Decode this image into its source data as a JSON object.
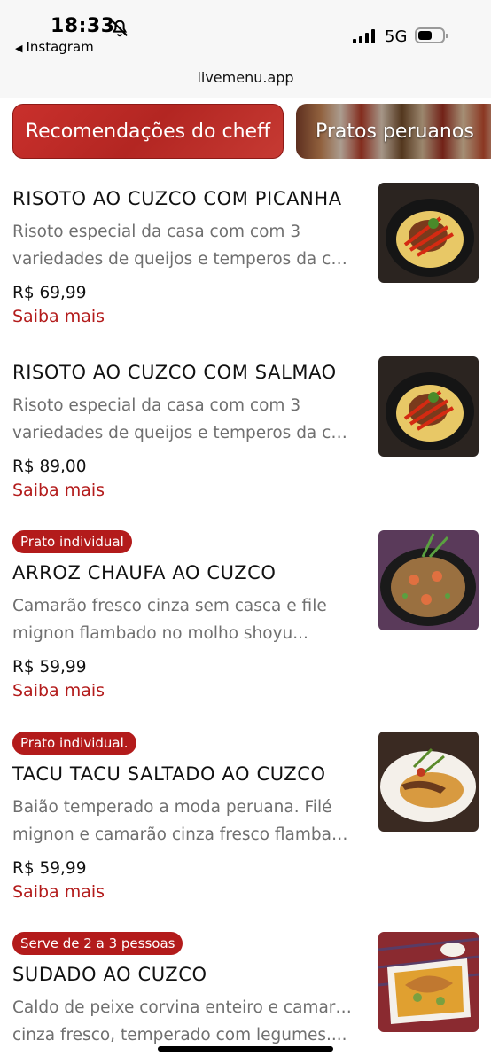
{
  "status_bar": {
    "time": "18:33",
    "back_app": "Instagram",
    "network": "5G"
  },
  "browser": {
    "url": "livemenu.app"
  },
  "categories": [
    {
      "label": "Recomendações do cheff"
    },
    {
      "label": "Pratos peruanos"
    }
  ],
  "items": [
    {
      "badge": "",
      "title": "RISOTO AO CUZCO COM PICANHA",
      "desc_line1": "Risoto especial da casa com com 3",
      "desc_line2": "variedades de queijos e temperos da cas...",
      "price": "R$ 69,99",
      "more": "Saiba mais"
    },
    {
      "badge": "",
      "title": "RISOTO AO CUZCO COM SALMAO",
      "desc_line1": "Risoto especial da casa com com 3",
      "desc_line2": "variedades de queijos e temperos da cas...",
      "price": "R$ 89,00",
      "more": "Saiba mais"
    },
    {
      "badge": "Prato individual",
      "title": "ARROZ CHAUFA AO CUZCO",
      "desc_line1": "Camarão fresco cinza sem casca e file",
      "desc_line2": "mignon flambado no molho shoyu...",
      "price": "R$ 59,99",
      "more": "Saiba mais"
    },
    {
      "badge": "Prato individual.",
      "title": "TACU TACU SALTADO AO CUZCO",
      "desc_line1": "Baião temperado a moda peruana. Filé",
      "desc_line2": "mignon e camarão cinza fresco flambado...",
      "price": "R$ 59,99",
      "more": "Saiba mais"
    },
    {
      "badge": "Serve de 2 a 3 pessoas",
      "title": "SUDADO AO CUZCO",
      "desc_line1": "Caldo de peixe corvina enteiro e camarão",
      "desc_line2": "cinza fresco, temperado com legumes....",
      "price": "",
      "more": ""
    }
  ],
  "colors": {
    "accent": "#b31b1b",
    "muted_text": "#6f6f6f"
  },
  "icons": [
    "bell-slash-icon",
    "back-triangle-icon",
    "signal-bars-icon",
    "battery-icon"
  ]
}
